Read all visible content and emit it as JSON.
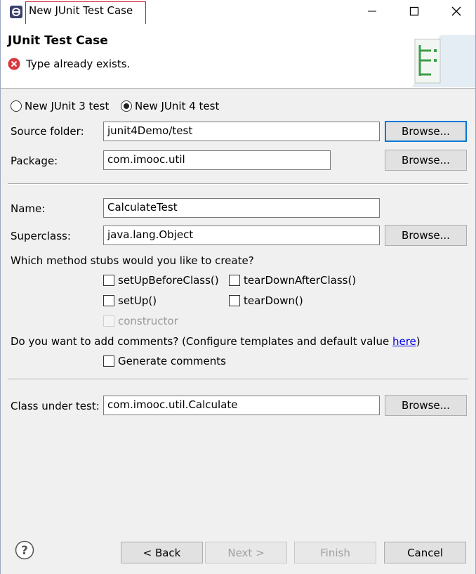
{
  "window": {
    "title": "New JUnit Test Case",
    "minimize_icon": "minimize-icon",
    "maximize_icon": "maximize-icon",
    "close_icon": "close-icon"
  },
  "banner": {
    "title": "JUnit Test Case",
    "message": "Type already exists.",
    "message_icon": "error-icon"
  },
  "version": {
    "junit3_label": "New JUnit 3 test",
    "junit4_label": "New JUnit 4 test",
    "selected": "junit4"
  },
  "form": {
    "source_folder_label": "Source folder:",
    "source_folder_value": "junit4Demo/test",
    "package_label": "Package:",
    "package_value": "com.imooc.util",
    "name_label": "Name:",
    "name_value": "CalculateTest",
    "superclass_label": "Superclass:",
    "superclass_value": "java.lang.Object",
    "browse_label": "Browse...",
    "stubs_question": "Which method stubs would you like to create?",
    "stubs": {
      "setUpBeforeClass": "setUpBeforeClass()",
      "tearDownAfterClass": "tearDownAfterClass()",
      "setUp": "setUp()",
      "tearDown": "tearDown()",
      "constructor": "constructor"
    },
    "comments_question_prefix": "Do you want to add comments? (Configure templates and default value ",
    "comments_link": "here",
    "comments_question_suffix": ")",
    "generate_comments": "Generate comments",
    "class_under_test_label": "Class under test:",
    "class_under_test_value": "com.imooc.util.Calculate"
  },
  "footer": {
    "back": "< Back",
    "next": "Next >",
    "finish": "Finish",
    "cancel": "Cancel"
  },
  "colors": {
    "highlight": "#c8202a",
    "error": "#d9363e",
    "link": "#0000ee",
    "focus": "#0078d7"
  }
}
